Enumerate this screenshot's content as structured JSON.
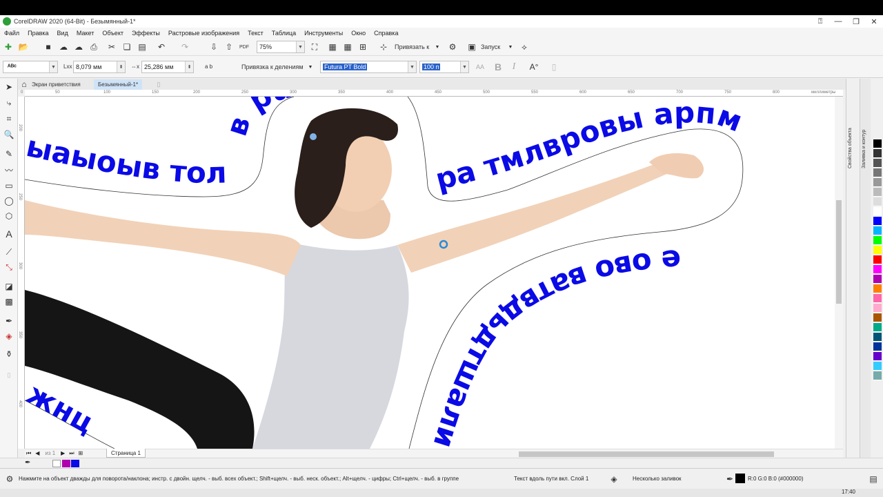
{
  "window": {
    "title": "CorelDRAW 2020 (64-Bit) - Безымянный-1*"
  },
  "menu": [
    "Файл",
    "Правка",
    "Вид",
    "Макет",
    "Объект",
    "Эффекты",
    "Растровые изображения",
    "Текст",
    "Таблица",
    "Инструменты",
    "Окно",
    "Справка"
  ],
  "toolbar": {
    "zoom_value": "75%",
    "snap_label": "Привязать к",
    "launch_label": "Запуск"
  },
  "propertybar": {
    "dist_label": "Lxx",
    "dist_value": "8,079 мм",
    "offset_label": "⇔x",
    "offset_value": "25,286 мм",
    "ab_label": "a b",
    "snap_marks": "Привязка к делениям",
    "font_name": "Futura PT Bold",
    "font_size": "100 п",
    "bold_label": "B",
    "italic_label": "I"
  },
  "doc_tabs": {
    "welcome": "Экран приветствия",
    "document": "Безымянный-1*"
  },
  "ruler": {
    "units": "миллиметры",
    "h_ticks": [
      "0",
      "50",
      "100",
      "150",
      "200",
      "250",
      "300",
      "350",
      "400",
      "450",
      "500",
      "550",
      "600",
      "650",
      "700",
      "750",
      "800"
    ],
    "v_ticks": [
      "200",
      "250",
      "300",
      "350",
      "400"
    ]
  },
  "canvas": {
    "path_texts": {
      "left_top": "ыаыоыв тол",
      "upper_vertical": "в ра",
      "upper_right": "ра тмлвровы арпм",
      "lower": "е ово ватвдьдтшалил",
      "bottom_left": "жнц"
    }
  },
  "page_nav": {
    "page_count": "из 1",
    "page_tab": "Страница 1"
  },
  "dockers": {
    "tab1": "Свойства объекта",
    "tab2": "Заливка и контур"
  },
  "palette_colors": [
    "#000000",
    "#333333",
    "#555555",
    "#777777",
    "#999999",
    "#bbbbbb",
    "#dddddd",
    "#ffffff",
    "#0000ff",
    "#00b4ff",
    "#00ff00",
    "#ffff00",
    "#ff0000",
    "#ff00ff",
    "#b000b0",
    "#ff8000",
    "#ff66aa",
    "#ffaacc",
    "#aa5500",
    "#00aa88",
    "#005577",
    "#003399",
    "#6600cc",
    "#33ccff",
    "#77aaaa"
  ],
  "status": {
    "hint": "Нажмите на объект дважды для поворота/наклона; инстр. с двойн. щелч. - выб. всех объект.; Shift+щелч. - выб. неск. объект.; Alt+щелч. - цифры; Ctrl+щелч. - выб. в группе",
    "object_info": "Текст вдоль пути вкл. Слой 1",
    "fill_info": "Несколько заливок",
    "outline_info": "R:0 G:0 B:0 (#000000)"
  },
  "taskbar": {
    "time": "17:40"
  },
  "colors": {
    "path_text": "#0a0ae6",
    "accent": "#2e9e3a"
  }
}
